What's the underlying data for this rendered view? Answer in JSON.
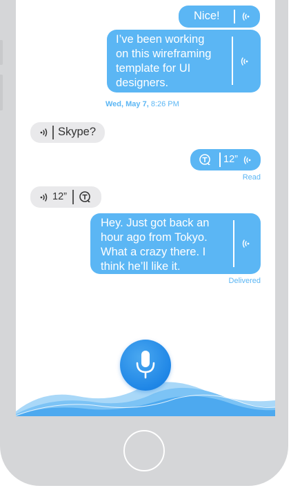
{
  "messages": {
    "nice": {
      "text": "Nice!"
    },
    "working": {
      "lines": [
        "I’ve been working",
        "on this wireframing",
        "template for UI",
        "designers."
      ]
    },
    "skype": {
      "text": "Skype?"
    },
    "voice_out": {
      "duration": "12”"
    },
    "voice_in": {
      "duration": "12”"
    },
    "tokyo": {
      "lines": [
        "Hey. Just got back an",
        "hour ago from Tokyo.",
        "What a crazy there. I",
        "think he’ll like it."
      ]
    }
  },
  "timestamp": {
    "date": "Wed, May 7,",
    "time": "8:26 PM"
  },
  "status": {
    "read": "Read",
    "delivered": "Delivered"
  },
  "icons": {
    "audio": "audio-wave-icon",
    "translate": "translate-icon",
    "mic": "microphone-icon",
    "wave": "sound-wave-decoration"
  },
  "colors": {
    "accent": "#5bb6f4",
    "mic": "#1f86e6",
    "incoming": "#e9e9eb",
    "frame": "#d5d6d8"
  }
}
